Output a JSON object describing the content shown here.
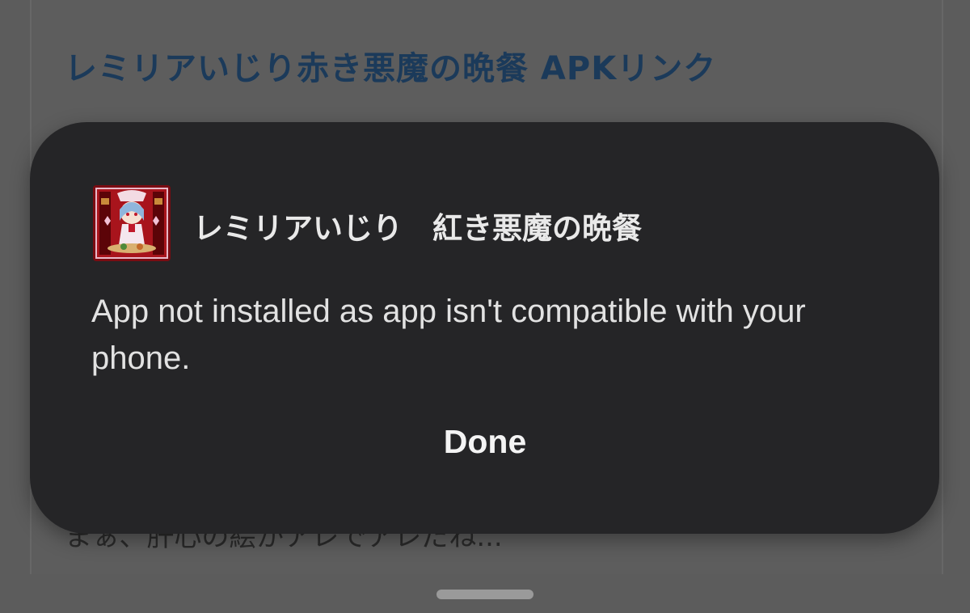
{
  "background": {
    "title": "レミリアいじり赤き悪魔の晩餐 APKリンク",
    "peek_text": "まぁ、肝心の絵がアレでアレだね..."
  },
  "dialog": {
    "app_name": "レミリアいじり　紅き悪魔の晩餐",
    "app_icon": "remilia-game-app-icon",
    "message": "App not installed as app isn't compatible with your phone.",
    "done_label": "Done"
  },
  "colors": {
    "dialog_bg": "#252527",
    "title_link": "#1c3c5c",
    "scrim": "#5e5e5e"
  }
}
